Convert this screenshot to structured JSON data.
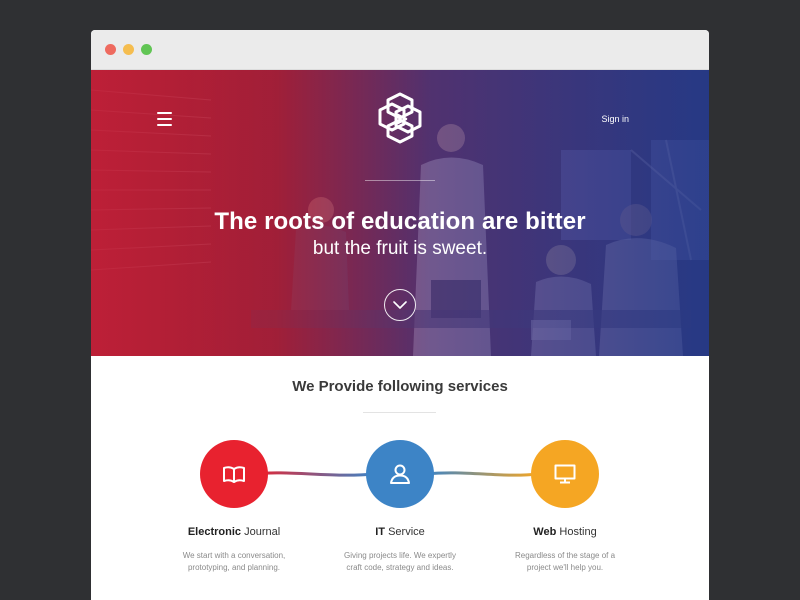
{
  "colors": {
    "background": "#2f3033",
    "titlebar": "#ebebeb",
    "close": "#ee6a5f",
    "minimize": "#f5bd4f",
    "maximize": "#61c554",
    "hero_red": "#c8213a",
    "hero_blue": "#283c8c",
    "service_red": "#e8222f",
    "service_blue": "#3d84c6",
    "service_yellow": "#f5a623"
  },
  "hero": {
    "signin_label": "Sign in",
    "title": "The roots of education are bitter",
    "subtitle": "but the fruit is sweet.",
    "menu_icon": "hamburger-menu-icon",
    "scroll_icon": "chevron-down-icon"
  },
  "services": {
    "heading": "We Provide following services",
    "items": [
      {
        "icon": "book-icon",
        "title_bold": "Electronic",
        "title_rest": "Journal",
        "desc": "We start with a conversation, prototyping, and planning."
      },
      {
        "icon": "user-icon",
        "title_bold": "IT",
        "title_rest": "Service",
        "desc": "Giving projects life. We expertly craft code, strategy and ideas."
      },
      {
        "icon": "monitor-icon",
        "title_bold": "Web",
        "title_rest": "Hosting",
        "desc": "Regardless of the stage of a project we'll help you."
      }
    ]
  }
}
